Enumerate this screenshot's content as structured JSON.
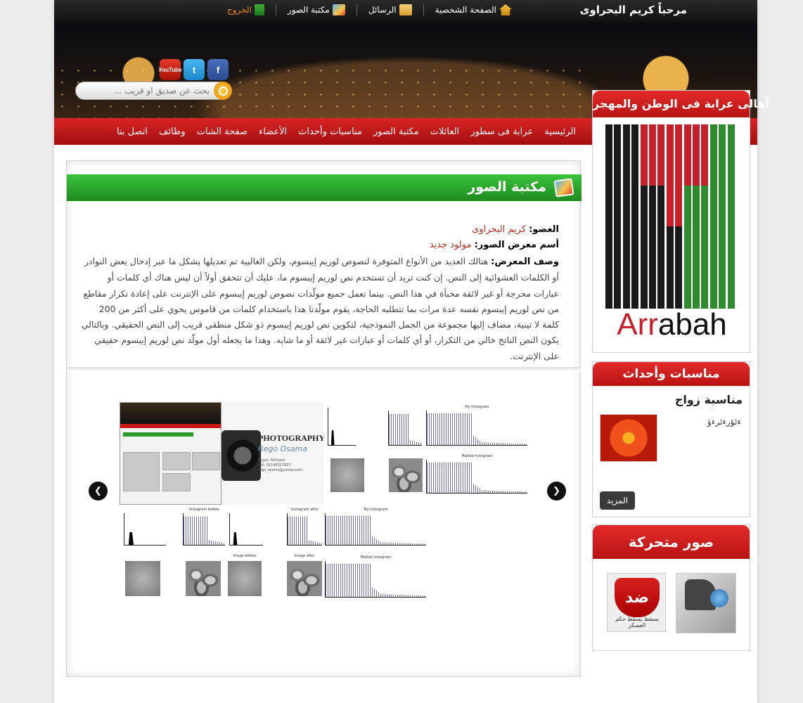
{
  "topbar": {
    "welcome": "مرحباً كريم البحراوى",
    "links": [
      {
        "label": "الصفحة الشخصية",
        "icon": "home-icon"
      },
      {
        "label": "الرسائل",
        "icon": "mail-icon"
      },
      {
        "label": "مكتبة الصور",
        "icon": "photo-library-icon"
      },
      {
        "label": "الخروج",
        "icon": "exit-icon"
      }
    ]
  },
  "header": {
    "social": [
      "YouTube",
      "t",
      "f"
    ],
    "search_placeholder": "بحث عن صديق او قريب ..."
  },
  "nav": {
    "items": [
      "الرئيسية",
      "عرابة فى سطور",
      "العائلات",
      "مكتبة الصور",
      "مناسبات وأحداث",
      "الأعضاء",
      "صفحة الشات",
      "وظائف",
      "اتصل بنا"
    ]
  },
  "sidebar": {
    "logo_title": "أهالى عرابة فى الوطن والمهجر",
    "logo_text_1": "Arr",
    "logo_text_2": "abah",
    "events_title": "مناسبات وأحداث",
    "event_name": "مناسبة زواج",
    "event_text": "ءئؤرءئرءؤ",
    "more_label": "المزيد",
    "gifs_title": "صور متحركة",
    "gif1_text": "ضد",
    "gif1_caption": "يسقط يسقط حكم العسكر"
  },
  "main": {
    "section_title": "مكتبة الصور",
    "member_label": "العضو:",
    "member_name": "كريم البحراوى",
    "gallery_label": "أسم معرض الصور:",
    "gallery_name": "مولود جديد",
    "desc_label": "وصف المعرض:",
    "desc_text": "هنالك العديد من الأنواع المتوفرة لنصوص لوريم إيبسوم، ولكن الغالبية تم تعديلها بشكل ما عبر إدخال بعض النوادر أو الكلمات العشوائية إلى النص. إن كنت تريد أن تستخدم نص لوريم إيبسوم ما، عليك أن تتحقق أولاً أن ليس هناك أي كلمات أو عبارات محرجة أو غير لائقة مخبأة في هذا النص. بينما تعمل جميع مولّدات نصوص لوريم إيبسوم على الإنترنت على إعادة تكرار مقاطع من نص لوريم إيبسوم نفسه عدة مرات بما تتطلبه الحاجة، يقوم مولّدنا هذا باستخدام كلمات من قاموس يحوي على أكثر من 200 كلمة لا تينية، مضاف إليها مجموعة من الجمل النموذجية، لتكوين نص لوريم إيبسوم ذو شكل منطقي قريب إلى النص الحقيقي. وبالتالي يكون النص الناتج خالي من التكرار، أو أي كلمات أو عبارات غير لائقة أو ما شابه. وهذا ما يجعله أول مولّد نص لوريم إيبسوم حقيقي على الإنترنت.",
    "photo_title": "PHOTOGRAPHY",
    "photo_sig": "Rego Osama",
    "photo_info": "Egypt, Portsaid\ncell. 01146317637\nrhgo_osama@yahoo.com",
    "hist_labels": [
      "My histogram",
      "Matlab histogram",
      "histogram before",
      "histogram after",
      "My histogram",
      "Image before",
      "Image after",
      "Matlab histogram"
    ]
  }
}
